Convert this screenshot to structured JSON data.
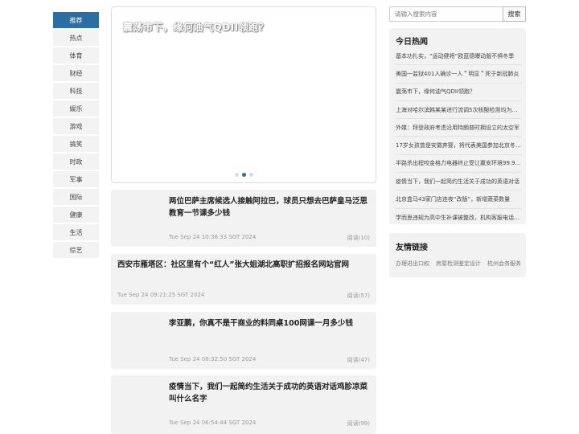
{
  "nav": {
    "items": [
      "推荐",
      "热点",
      "体育",
      "财经",
      "科技",
      "娱乐",
      "游戏",
      "搞笑",
      "时政",
      "军事",
      "国际",
      "健康",
      "生活",
      "综艺"
    ],
    "active_index": 0
  },
  "banner": {
    "title": "震荡市下，缘何油气QDII领跑？",
    "slide_count": 3,
    "active_slide": 1
  },
  "articles": [
    {
      "title": "两位巴萨主席候选人接触阿拉巴，球员只想去巴萨皇马泛思教育一节课多少钱",
      "date": "Tue Sep 24 10:38:33 SGT 2024",
      "reads": "阅读(10)"
    },
    {
      "title": "西安市雁塔区：社区里有个“红人”张大姐湖北高职扩招报名网站官网",
      "date": "Tue Sep 24 09:21:25 SGT 2024",
      "reads": "阅读(57)"
    },
    {
      "title": "李亚鹏，你真不是干商业的料同桌100网课一月多少钱",
      "date": "Tue Sep 24 08:32:50 SGT 2024",
      "reads": "阅读(47)"
    },
    {
      "title": "疫情当下，我们一起简约生活关于成功的英语对话鸡胗凉菜叫什么名字",
      "date": "Tue Sep 24 06:54:44 SGT 2024",
      "reads": "阅读(99)"
    }
  ],
  "search": {
    "placeholder": "请输入搜索内容",
    "button_label": "搜索"
  },
  "hot": {
    "title": "今日热闻",
    "items": [
      "基本功扎实，“运动健将”欧蓝德曝动版不惧冬季",
      "美国一监狱401人确诊一人＂明显＂死于新冠肺炎",
      "震荡市下，缘何油气QDII领跑？",
      "上海对哈尔滨韩某某进行流调5次核酸检测均为阴性",
      "外媒：拜登政府考虑沿用特朗普时期设立的太空军",
      "17岁女孩曾是安徽弃婴，将代表美国参加北京冬奥会",
      "半路杀出程咬金格力电器终止受让赢安环境99.97%股权",
      "疫情当下，我们一起简约生活关于成功的英语对话",
      "北京盒马43家门店连夜“改版”，新增蔬菜数量",
      "学而思违规为高中生补课被整改，机构客服电话无人接听"
    ]
  },
  "friends": {
    "title": "友情链接",
    "links": [
      "办理进出口权",
      "房屋检测鉴定设计",
      "杭州会务服务"
    ]
  }
}
